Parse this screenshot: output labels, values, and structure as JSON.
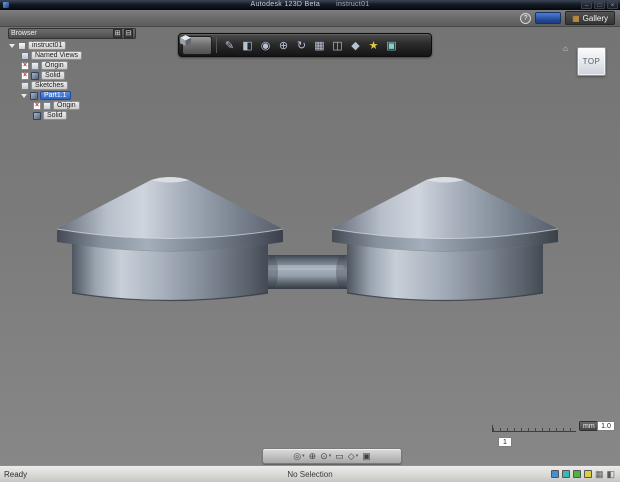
{
  "window": {
    "title": "Autodesk 123D Beta",
    "doc": "instruct01",
    "controls": {
      "min": "–",
      "max": "□",
      "close": "×"
    }
  },
  "ui": {
    "caret": "▾",
    "x_glyph": "×"
  },
  "menubar": {
    "help_glyph": "?",
    "gallery_label": "Gallery",
    "gallery_icon_glyph": "▦"
  },
  "browser": {
    "header": "Browser",
    "header_buttons": [
      {
        "name": "expand-all",
        "glyph": "⊞"
      },
      {
        "name": "collapse-all",
        "glyph": "⊟"
      }
    ],
    "rows": [
      {
        "label": "instruct01"
      },
      {
        "label": "Named Views"
      },
      {
        "label": "Origin"
      },
      {
        "label": "Solid"
      },
      {
        "label": "Sketches"
      },
      {
        "label": "Part1.1"
      },
      {
        "label": "Origin"
      },
      {
        "label": "Solid"
      }
    ]
  },
  "toolbar": {
    "tools": [
      {
        "name": "pencil",
        "glyph": "✎"
      },
      {
        "name": "box",
        "glyph": "◧"
      },
      {
        "name": "sphere",
        "glyph": "◉"
      },
      {
        "name": "move",
        "glyph": "⊕"
      },
      {
        "name": "rotate",
        "glyph": "↻"
      },
      {
        "name": "grid",
        "glyph": "▦"
      },
      {
        "name": "combine",
        "glyph": "◫"
      },
      {
        "name": "diamond",
        "glyph": "◆"
      },
      {
        "name": "star",
        "glyph": "★"
      },
      {
        "name": "panel",
        "glyph": "▣"
      }
    ]
  },
  "viewcube": {
    "label": "TOP",
    "home_glyph": "⌂"
  },
  "nav": {
    "icons": [
      {
        "name": "orbit",
        "glyph": "◎"
      },
      {
        "name": "pan",
        "glyph": "⊕"
      },
      {
        "name": "zoom",
        "glyph": "⊙"
      },
      {
        "name": "fit-view",
        "glyph": "▭"
      },
      {
        "name": "view-mode",
        "glyph": "◇"
      },
      {
        "name": "display-style",
        "glyph": "▣"
      }
    ]
  },
  "scale": {
    "unit": "mm",
    "value": "1.0",
    "grid": "1"
  },
  "statusbar": {
    "left": "Ready",
    "center": "No Selection",
    "grid_glyph": "▦",
    "snap_glyph": "◧",
    "indicator_colors": [
      "#3f8fd6",
      "#38b8b0",
      "#4db43e",
      "#d9ce3c"
    ]
  },
  "colors": {
    "selection": "#2f64c4",
    "canvas": "#7c7c7c",
    "titlebar": "#0c1018",
    "steel": "#9aa4b2"
  }
}
